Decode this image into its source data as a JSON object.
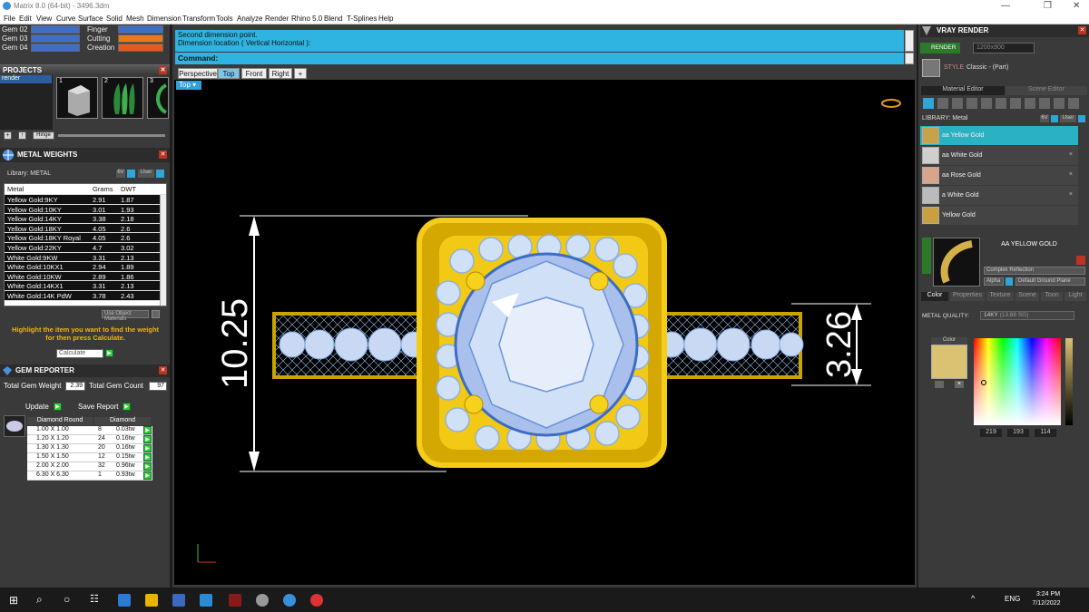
{
  "window": {
    "title": "Matrix 8.0 (64-bit) - 3496.3dm"
  },
  "menu": [
    "File",
    "Edit",
    "View",
    "Curve",
    "Surface",
    "Solid",
    "Mesh",
    "Dimension",
    "Transform",
    "Tools",
    "Analyze",
    "Render",
    "Rhino 5.0",
    "Blend",
    "T-Splines",
    "Help"
  ],
  "layers": [
    {
      "name": "Gem 02",
      "tag": "Finger"
    },
    {
      "name": "Gem 03",
      "tag": "Cutting"
    },
    {
      "name": "Gem 04",
      "tag": "Creation"
    }
  ],
  "projects": {
    "title": "PROJECTS",
    "item": "render",
    "thumbs": [
      "1",
      "2",
      "3"
    ],
    "hinge": "Hinge"
  },
  "metal_weights": {
    "title": "METAL WEIGHTS",
    "library": "Library: METAL",
    "lib_opts": [
      "6V",
      "User"
    ],
    "headers": [
      "Metal",
      "Grams",
      "DWT"
    ],
    "rows": [
      [
        "Yellow Gold:9KY",
        "2.91",
        "1.87"
      ],
      [
        "Yellow Gold:10KY",
        "3.01",
        "1.93"
      ],
      [
        "Yellow Gold:14KY",
        "3.38",
        "2.18"
      ],
      [
        "Yellow Gold:18KY",
        "4.05",
        "2.6"
      ],
      [
        "Yellow Gold:18KY Royal",
        "4.05",
        "2.6"
      ],
      [
        "Yellow Gold:22KY",
        "4.7",
        "3.02"
      ],
      [
        "White Gold:9KW",
        "3.31",
        "2.13"
      ],
      [
        "White Gold:10KX1",
        "2.94",
        "1.89"
      ],
      [
        "White Gold:10KW",
        "2.89",
        "1.86"
      ],
      [
        "White Gold:14KX1",
        "3.31",
        "2.13"
      ],
      [
        "White Gold:14K PdW",
        "3.78",
        "2.43"
      ]
    ],
    "use_object_materials": "Use Object Materials",
    "hint": "Highlight the item you want to find the weight for then press Calculate.",
    "calculate": "Calculate"
  },
  "gem_reporter": {
    "title": "GEM REPORTER",
    "total_weight_label": "Total Gem Weight",
    "total_weight": "2.39",
    "total_count_label": "Total Gem Count",
    "total_count": "97",
    "update": "Update",
    "save": "Save Report",
    "col1": "Diamond Round",
    "col2": "Diamond",
    "rows": [
      [
        "1.00 X 1.00",
        "8",
        "0.03tw"
      ],
      [
        "1.20 X 1.20",
        "24",
        "0.16tw"
      ],
      [
        "1.30 X 1.30",
        "20",
        "0.16tw"
      ],
      [
        "1.50 X 1.50",
        "12",
        "0.15tw"
      ],
      [
        "2.00 X 2.00",
        "32",
        "0.96tw"
      ],
      [
        "6.30 X 6.30",
        "1",
        "0.93tw"
      ]
    ]
  },
  "command": {
    "history": [
      "Second dimension point.",
      "Dimension location ( Vertical  Horizontal ):"
    ],
    "label": "Command:"
  },
  "viewtabs": [
    "Perspective",
    "Top",
    "Front",
    "Right"
  ],
  "viewport": {
    "label": "Top",
    "dim_height": "10.25",
    "dim_band": "3.26"
  },
  "vray": {
    "title": "VRAY RENDER",
    "render": "RENDER",
    "resolution": "1200x900",
    "style_label": "STYLE",
    "style": "Classic - (Part)",
    "tabs": [
      "Material Editor",
      "Scene Editor"
    ],
    "library": "LIBRARY: Metal",
    "lib_opts": [
      "6V",
      "User"
    ],
    "materials": [
      "aa Yellow Gold",
      "aa White Gold",
      "aa Rose Gold",
      "a White Gold",
      "Yellow Gold"
    ],
    "preview_name": "AA YELLOW GOLD",
    "reflection": "Complex Reflection",
    "alpha": "Alpha",
    "ground": "Default Ground Plane",
    "subtabs": [
      "Color",
      "Properties",
      "Texture",
      "Scene",
      "Toon",
      "Light"
    ],
    "metal_quality_label": "METAL QUALITY:",
    "metal_quality": "14KY",
    "mq_extra": "(13.88 SG)",
    "color_label": "Color",
    "rgb": [
      "219",
      "193",
      "114"
    ],
    "swatch": "#dbc172"
  },
  "taskbar": {
    "time": "3:24 PM",
    "date": "7/12/2022",
    "lang": "ENG"
  }
}
